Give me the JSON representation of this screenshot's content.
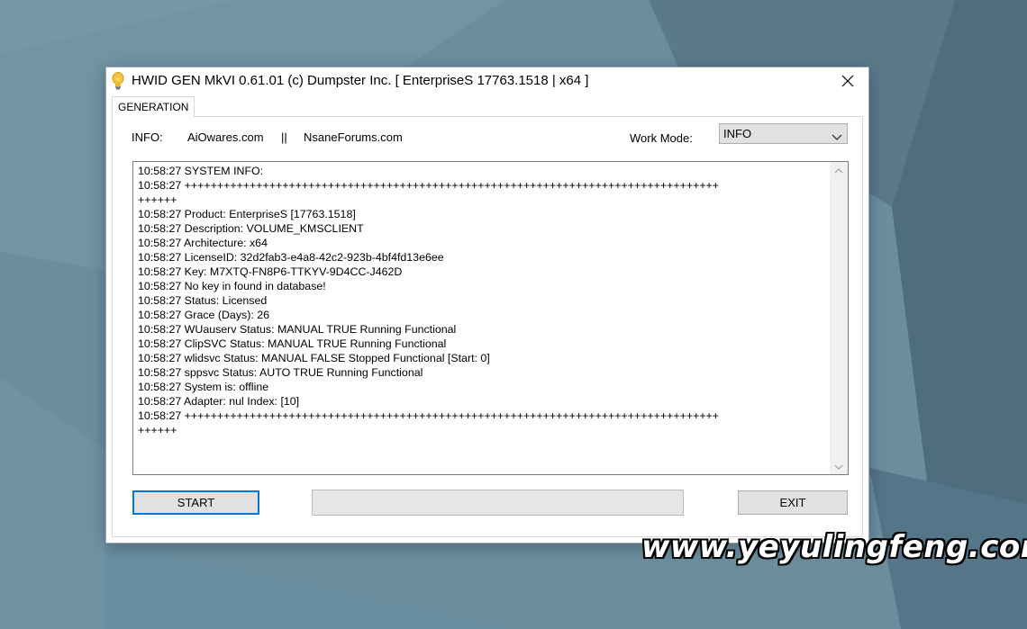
{
  "window": {
    "title": "HWID GEN MkVI 0.61.01 (c) Dumpster Inc. [ EnterpriseS 17763.1518 | x64 ]"
  },
  "tabs": [
    {
      "label": "GENERATION"
    }
  ],
  "info": {
    "label": "INFO:",
    "link1": "AiOwares.com",
    "separator": "||",
    "link2": "NsaneForums.com"
  },
  "work_mode": {
    "label": "Work Mode:",
    "selected": "INFO"
  },
  "log": {
    "lines": [
      "10:58:27 SYSTEM INFO:",
      "10:58:27 ++++++++++++++++++++++++++++++++++++++++++++++++++++++++++++++++++++++++++++++++++",
      "++++++",
      "10:58:27 Product: EnterpriseS [17763.1518]",
      "10:58:27 Description: VOLUME_KMSCLIENT",
      "10:58:27 Architecture: x64",
      "10:58:27 LicenseID: 32d2fab3-e4a8-42c2-923b-4bf4fd13e6ee",
      "10:58:27 Key: M7XTQ-FN8P6-TTKYV-9D4CC-J462D",
      "10:58:27 No key in found in database!",
      "10:58:27 Status: Licensed",
      "10:58:27 Grace (Days): 26",
      "10:58:27 WUauserv Status: MANUAL TRUE Running Functional",
      "10:58:27 ClipSVC Status: MANUAL TRUE Running Functional",
      "10:58:27 wlidsvc Status: MANUAL FALSE Stopped Functional [Start: 0]",
      "10:58:27 sppsvc Status: AUTO TRUE Running Functional",
      "10:58:27 System is: offline",
      "10:58:27 Adapter: nul Index: [10]",
      "10:58:27 ++++++++++++++++++++++++++++++++++++++++++++++++++++++++++++++++++++++++++++++++++",
      "++++++"
    ]
  },
  "buttons": {
    "start": "START",
    "exit": "EXIT"
  },
  "progress": {
    "value": 0
  },
  "watermark": "www.yeyulingfeng.com",
  "icons": {
    "app": "lightbulb-icon",
    "close": "close-icon",
    "dropdown": "chevron-down-icon",
    "scroll_up": "chevron-up-icon",
    "scroll_down": "chevron-down-icon"
  },
  "colors": {
    "accent": "#0078d7",
    "button_face": "#e1e1e1",
    "progress_fill": "#06b025"
  }
}
